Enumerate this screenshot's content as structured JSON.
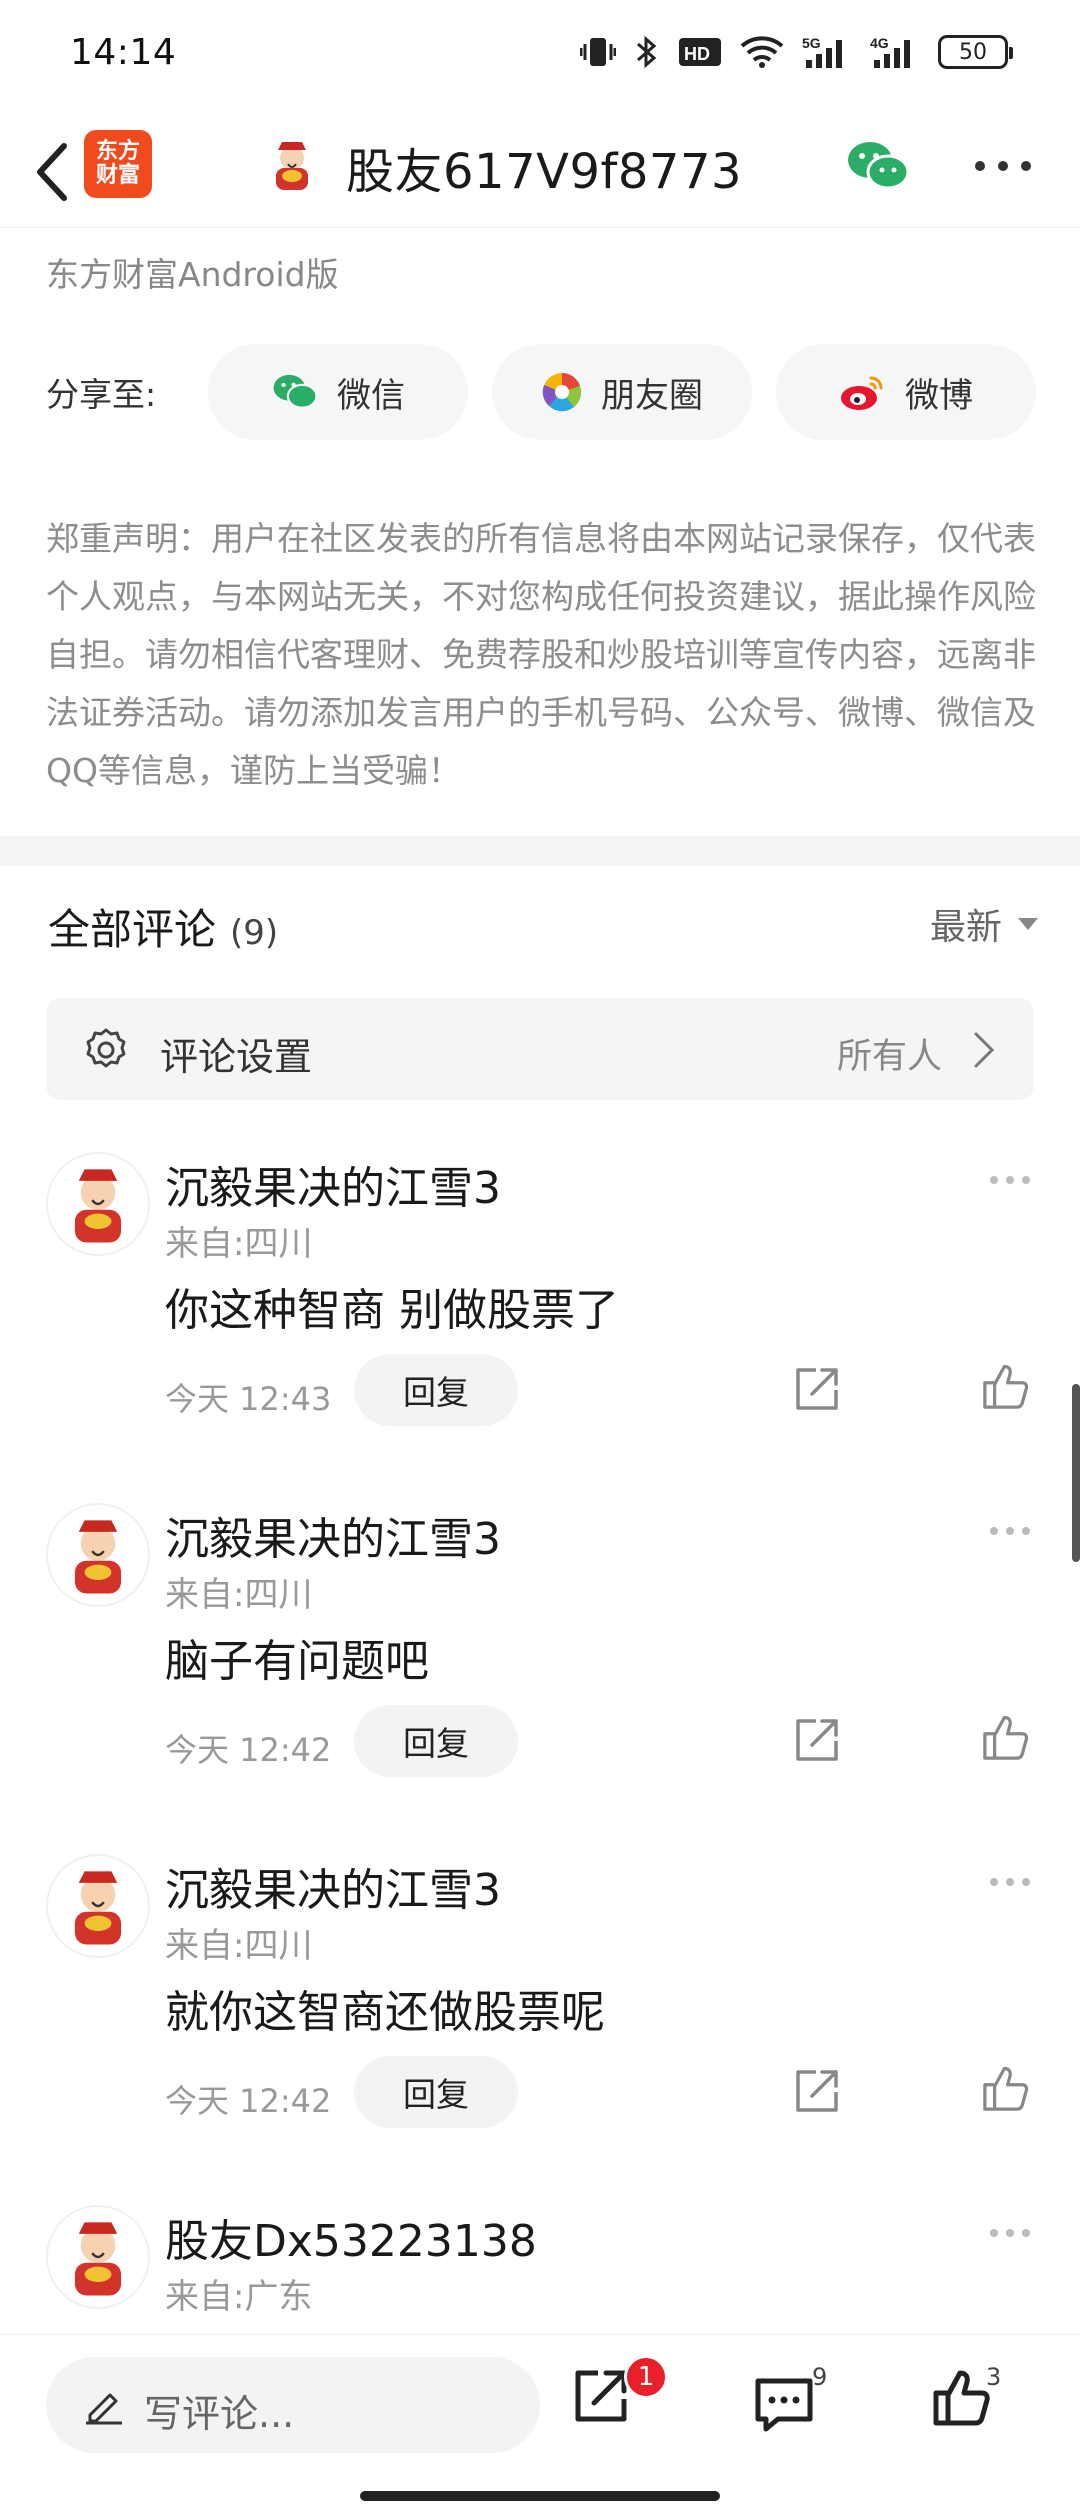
{
  "status_bar": {
    "time": "14:14",
    "battery": "50",
    "hd_label": "HD",
    "net1": "5G",
    "net2": "4G"
  },
  "header": {
    "app_logo_line1": "东方",
    "app_logo_line2": "财富",
    "title": "股友617V9f8773"
  },
  "source": "东方财富Android版",
  "share": {
    "label": "分享至:",
    "options": [
      {
        "label": "微信",
        "icon": "wechat-icon"
      },
      {
        "label": "朋友圈",
        "icon": "moments-icon"
      },
      {
        "label": "微博",
        "icon": "weibo-icon"
      }
    ]
  },
  "disclaimer": "郑重声明：用户在社区发表的所有信息将由本网站记录保存，仅代表个人观点，与本网站无关，不对您构成任何投资建议，据此操作风险自担。请勿相信代客理财、免费荐股和炒股培训等宣传内容，远离非法证券活动。请勿添加发言用户的手机号码、公众号、微博、微信及QQ等信息，谨防上当受骗！",
  "comments_section": {
    "title": "全部评论",
    "count": "(9)",
    "sort": "最新",
    "settings_label": "评论设置",
    "settings_value": "所有人"
  },
  "comments": [
    {
      "name": "沉毅果决的江雪3",
      "location": "来自:四川",
      "text": "你这种智商 别做股票了",
      "time": "今天 12:43",
      "reply": "回复"
    },
    {
      "name": "沉毅果决的江雪3",
      "location": "来自:四川",
      "text": "脑子有问题吧",
      "time": "今天 12:42",
      "reply": "回复"
    },
    {
      "name": "沉毅果决的江雪3",
      "location": "来自:四川",
      "text": "就你这智商还做股票呢",
      "time": "今天 12:42",
      "reply": "回复"
    },
    {
      "name": "股友Dx53223138",
      "location": "来自:广东",
      "text": "",
      "time": "",
      "reply": ""
    }
  ],
  "bottom_bar": {
    "placeholder": "写评论...",
    "share_badge": "1",
    "comment_count": "9",
    "like_count": "3"
  },
  "colors": {
    "brand": "#f04a1d",
    "wechat": "#2aae67",
    "badge": "#e8202a"
  }
}
